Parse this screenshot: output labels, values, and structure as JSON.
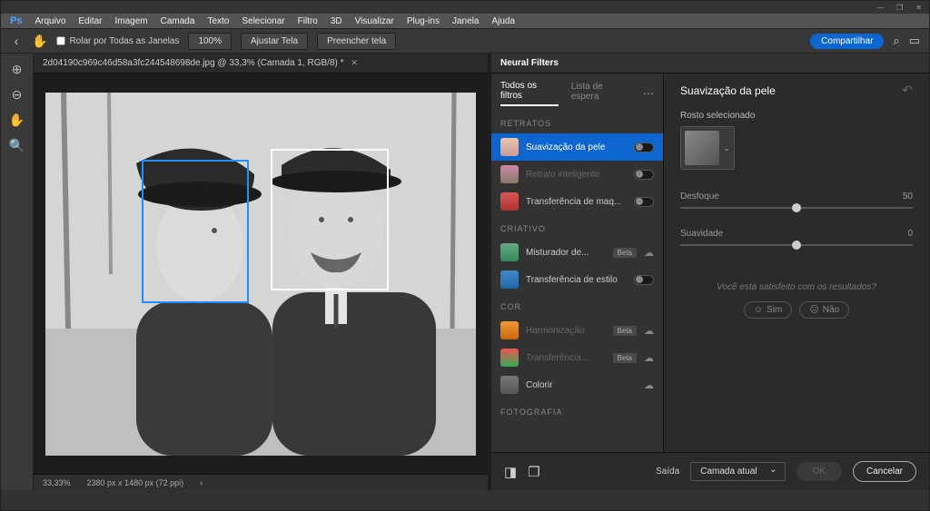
{
  "window": {
    "controls": [
      "—",
      "❐",
      "✕"
    ]
  },
  "menu": {
    "logo": "Ps",
    "items": [
      "Arquivo",
      "Editar",
      "Imagem",
      "Camada",
      "Texto",
      "Selecionar",
      "Filtro",
      "3D",
      "Visualizar",
      "Plug-ins",
      "Janela",
      "Ajuda"
    ]
  },
  "options_bar": {
    "scroll_all": "Rolar por Todas as Janelas",
    "zoom": "100%",
    "fit_screen": "Ajustar Tela",
    "fill_screen": "Preencher tela",
    "share": "Compartilhar"
  },
  "document": {
    "tab_title": "2d04190c969c46d58a3fc244548698de.jpg @ 33,3% (Camada 1, RGB/8) *",
    "zoom": "33,33%",
    "dims": "2380 px x 1480 px (72 ppi)"
  },
  "panel": {
    "title": "Neural Filters",
    "tabs": {
      "all": "Todos os filtros",
      "wait": "Lista de espera"
    },
    "groups": {
      "portraits": "RETRATOS",
      "creative": "CRIATIVO",
      "color": "COR",
      "photography": "FOTOGRAFIA"
    },
    "filters": {
      "skin": "Suavização da pele",
      "smart": "Retrato inteligente",
      "makeup": "Transferência de maq...",
      "mixer": "Misturador de...",
      "style": "Transferência de estilo",
      "harmon": "Harmonização",
      "color_transfer": "Transferência...",
      "colorize": "Colorir"
    },
    "beta": "Beta"
  },
  "settings": {
    "title": "Suavização da pele",
    "face_label": "Rosto selecionado",
    "sliders": {
      "blur_label": "Desfoque",
      "blur_val": "50",
      "smooth_label": "Suavidade",
      "smooth_val": "0"
    },
    "feedback_q": "Você está satisfeito com os resultados?",
    "yes": "Sim",
    "no": "Não"
  },
  "footer": {
    "output_label": "Saída",
    "output_value": "Camada atual",
    "ok": "OK",
    "cancel": "Cancelar"
  }
}
